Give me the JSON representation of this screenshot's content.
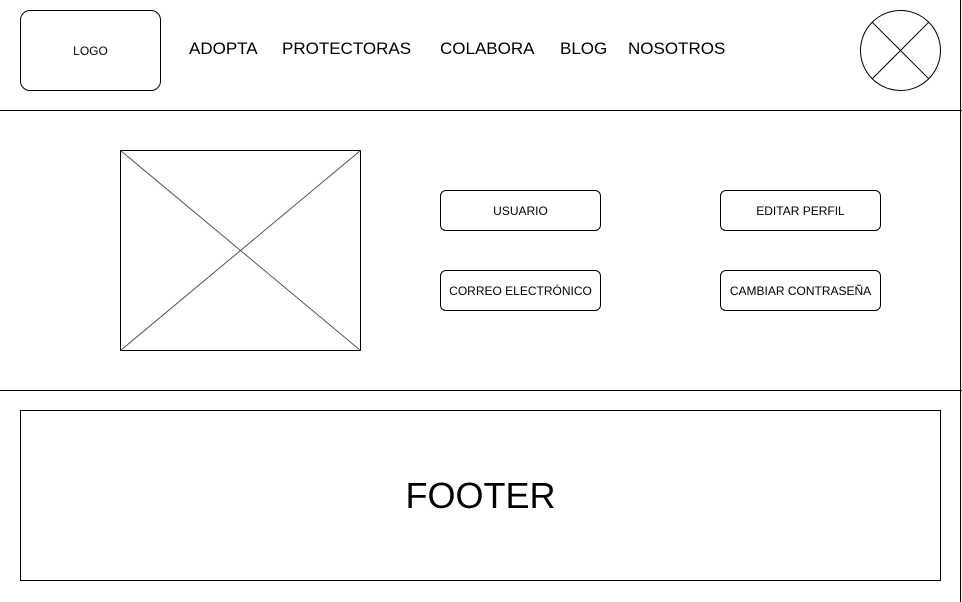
{
  "header": {
    "logo_label": "LOGO",
    "nav": [
      {
        "label": "ADOPTA"
      },
      {
        "label": "PROTECTORAS"
      },
      {
        "label": "COLABORA"
      },
      {
        "label": "BLOG"
      },
      {
        "label": "NOSOTROS"
      }
    ],
    "avatar_icon": "placeholder-circle-icon"
  },
  "profile": {
    "image_icon": "image-placeholder-icon",
    "fields": {
      "user_label": "USUARIO",
      "email_label": "CORREO ELECTRÓNICO"
    },
    "actions": {
      "edit_label": "EDITAR PERFIL",
      "change_password_label": "CAMBIAR CONTRASEÑA"
    }
  },
  "footer": {
    "label": "FOOTER"
  },
  "colors": {
    "line": "#000000",
    "placeholder_stroke": "#555555",
    "background": "#ffffff"
  }
}
